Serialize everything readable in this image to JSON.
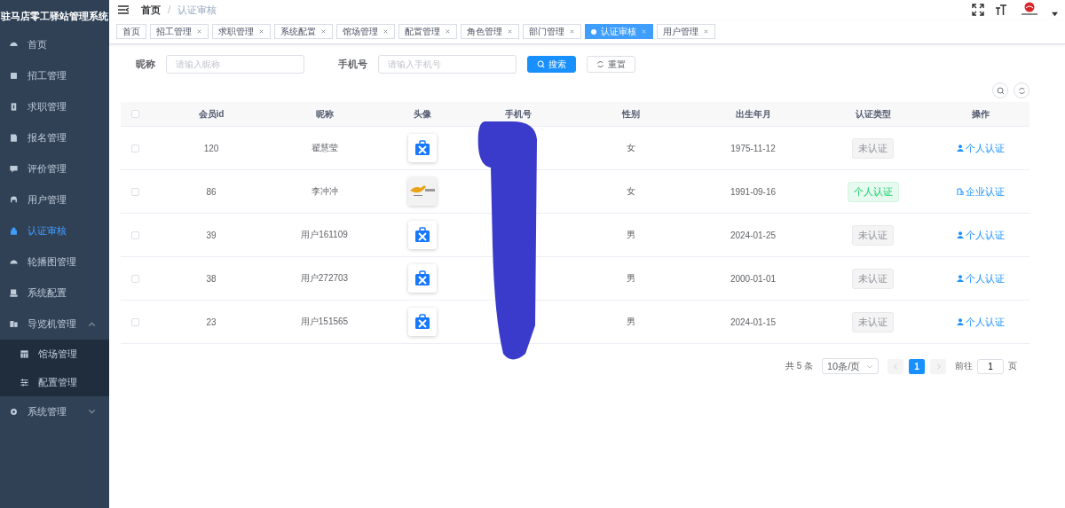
{
  "sidebar": {
    "title": "驻马店零工驿站管理系统",
    "items": [
      {
        "label": "首页",
        "selected": false
      },
      {
        "label": "招工管理",
        "selected": false
      },
      {
        "label": "求职管理",
        "selected": false
      },
      {
        "label": "报名管理",
        "selected": false
      },
      {
        "label": "评价管理",
        "selected": false
      },
      {
        "label": "用户管理",
        "selected": false
      },
      {
        "label": "认证审核",
        "selected": true
      },
      {
        "label": "轮播图管理",
        "selected": false
      },
      {
        "label": "系统配置",
        "selected": false
      },
      {
        "label": "导览机管理",
        "selected": false,
        "expanded": true,
        "children": [
          {
            "label": "馆场管理",
            "selected": false
          },
          {
            "label": "配置管理",
            "selected": false
          }
        ]
      },
      {
        "label": "系统管理",
        "selected": false,
        "expanded": false
      }
    ]
  },
  "breadcrumb": {
    "items": [
      "首页",
      "认证审核"
    ],
    "separator": "/"
  },
  "tabs": [
    {
      "label": "首页",
      "selected": false,
      "closable": false
    },
    {
      "label": "招工管理",
      "selected": false,
      "closable": true
    },
    {
      "label": "求职管理",
      "selected": false,
      "closable": true
    },
    {
      "label": "系统配置",
      "selected": false,
      "closable": true
    },
    {
      "label": "馆场管理",
      "selected": false,
      "closable": true
    },
    {
      "label": "配置管理",
      "selected": false,
      "closable": true
    },
    {
      "label": "角色管理",
      "selected": false,
      "closable": true
    },
    {
      "label": "部门管理",
      "selected": false,
      "closable": true
    },
    {
      "label": "认证审核",
      "selected": true,
      "closable": true
    },
    {
      "label": "用户管理",
      "selected": false,
      "closable": true
    }
  ],
  "search": {
    "fields": [
      {
        "label": "昵称",
        "placeholder": "请输入昵称"
      },
      {
        "label": "手机号",
        "placeholder": "请输入手机号"
      }
    ],
    "search_button": "搜索",
    "reset_button": "重置"
  },
  "table": {
    "select_all_checked": false,
    "columns": [
      "会员id",
      "昵称",
      "头像",
      "手机号",
      "性别",
      "出生年月",
      "认证类型",
      "操作"
    ],
    "rows": [
      {
        "checked": false,
        "id": "120",
        "nickname": "翟慧莹",
        "avatar": {
          "kind": "icon"
        },
        "gender": "女",
        "birth": "1975-11-12",
        "auth": {
          "text": "未认证",
          "kind": "none"
        },
        "action": {
          "text": "个人认证",
          "kind": "person"
        }
      },
      {
        "checked": false,
        "id": "86",
        "nickname": "李冲冲",
        "gender": "女",
        "birth": "1991-09-16",
        "auth": {
          "text": "个人认证",
          "kind": "personal"
        },
        "action": {
          "text": "企业认证",
          "kind": "company"
        }
      },
      {
        "checked": false,
        "id": "39",
        "nickname": "用户161109",
        "avatar": {
          "kind": "icon"
        },
        "gender": "男",
        "birth": "2024-01-25",
        "auth": {
          "text": "未认证",
          "kind": "none"
        },
        "action": {
          "text": "个人认证",
          "kind": "person"
        }
      },
      {
        "checked": false,
        "id": "38",
        "nickname": "用户272703",
        "avatar": {
          "kind": "icon"
        },
        "gender": "男",
        "birth": "2000-01-01",
        "auth": {
          "text": "未认证",
          "kind": "none"
        },
        "action": {
          "text": "个人认证",
          "kind": "person"
        }
      },
      {
        "checked": false,
        "id": "23",
        "nickname": "用户151565",
        "avatar": {
          "kind": "icon"
        },
        "gender": "男",
        "birth": "2024-01-15",
        "auth": {
          "text": "未认证",
          "kind": "none"
        },
        "action": {
          "text": "个人认证",
          "kind": "person"
        }
      }
    ]
  },
  "pagination": {
    "total": "共 5 条",
    "page_size": "10条/页",
    "pages": [
      {
        "label": "1",
        "selected": true
      }
    ],
    "goto_label": "前往",
    "goto_value": "1",
    "goto_suffix": "页"
  }
}
